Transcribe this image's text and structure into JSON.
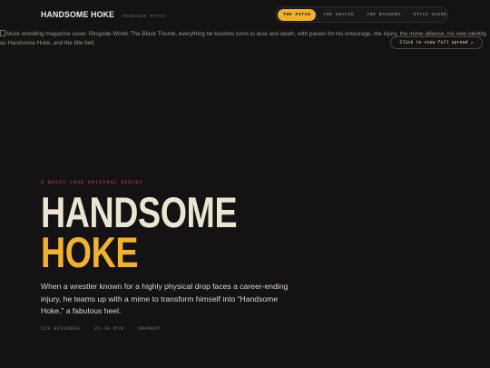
{
  "header": {
    "title": "HANDSOME HOKE",
    "subtitle": "RINGSIDE PITCH",
    "nav": [
      {
        "label": "THE PITCH",
        "active": true
      },
      {
        "label": "THE DEVLOG",
        "active": false
      },
      {
        "label": "THE BACKEND",
        "active": false
      },
      {
        "label": "STYLE GUIDE",
        "active": false
      }
    ]
  },
  "cover": {
    "alt": "Mock wrestling magazine cover. Ringside World: The Black Thumb, everything he touches turns to dust and death, with panels for his entourage, the injury, the mime alliance, his new identity as Handsome Hoke, and the title belt.",
    "view_button": "Click to view full spread ↗"
  },
  "hero": {
    "eyebrow": "A BUSSY LOVE ORIGINAL SERIES",
    "title_line_1": "HANDSOME",
    "title_line_2": "HOKE",
    "lede": "When a wrestler known for a highly physical drop faces a career-ending injury, he teams up with a mime to transform himself into “Handsome Hoke,” a fabulous heel.",
    "meta": [
      "SIX EPISODES",
      "22–30 MIN",
      "DRAMEDY"
    ]
  },
  "colors": {
    "background": "#141213",
    "accent": "#eeb033",
    "eyebrow": "#c24a5b",
    "title": "#ece5d4"
  }
}
